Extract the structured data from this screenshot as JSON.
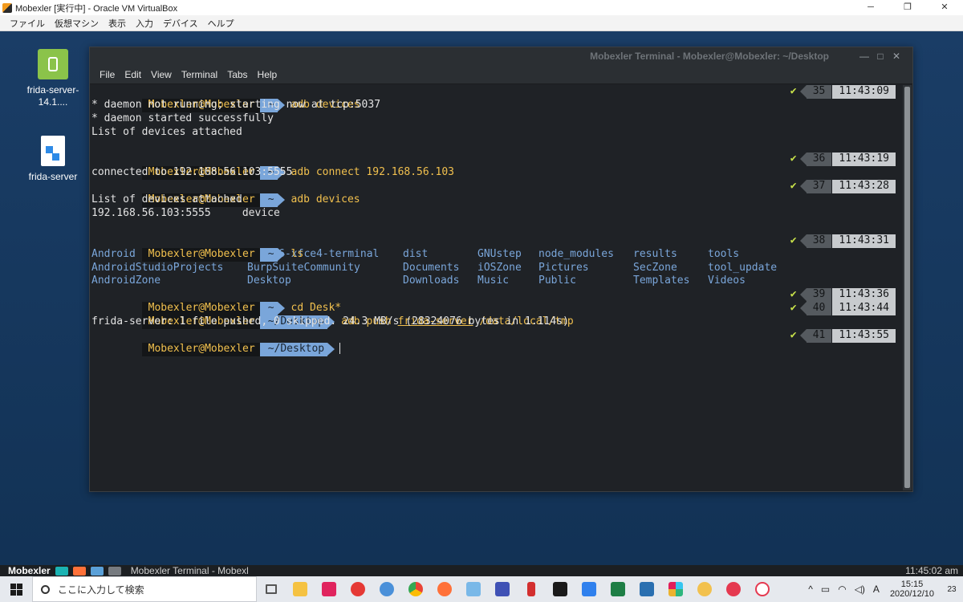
{
  "host": {
    "window_title": "Mobexler [実行中] - Oracle VM VirtualBox",
    "controls": {
      "minimize": "─",
      "restore": "❐",
      "close": "✕"
    },
    "menu": [
      "ファイル",
      "仮想マシン",
      "表示",
      "入力",
      "デバイス",
      "ヘルプ"
    ]
  },
  "desktop": {
    "icons": [
      {
        "label": "frida-server-14.1....",
        "icon": "apk-file-icon"
      },
      {
        "label": "frida-server",
        "icon": "binary-file-icon"
      }
    ]
  },
  "terminal": {
    "title": "Mobexler Terminal - Mobexler@Mobexler: ~/Desktop",
    "controls": {
      "minimize": "—",
      "maximize": "□",
      "close": "✕"
    },
    "menu": [
      "File",
      "Edit",
      "View",
      "Terminal",
      "Tabs",
      "Help"
    ],
    "prompt_user": "Mobexler@Mobexler",
    "check": "✔",
    "lines": {
      "p1": {
        "dir": "~",
        "cmd": "adb devices",
        "num": "35",
        "time": "11:43:09"
      },
      "o1": "* daemon not running; starting now at tcp:5037",
      "o2": "* daemon started successfully",
      "o3": "List of devices attached",
      "p2": {
        "dir": "~",
        "cmd": "adb connect 192.168.56.103",
        "num": "36",
        "time": "11:43:19"
      },
      "o4": "connected to 192.168.56.103:5555",
      "p3": {
        "dir": "~",
        "cmd": "adb devices",
        "num": "37",
        "time": "11:43:28"
      },
      "o5": "List of devices attached",
      "o6": "192.168.56.103:5555     device",
      "p4": {
        "dir": "~",
        "cmd": "ls",
        "num": "38",
        "time": "11:43:31"
      },
      "ls": [
        [
          "Android",
          "base16-xfce4-terminal",
          "dist",
          "GNUstep",
          "node_modules",
          "results",
          "tools"
        ],
        [
          "AndroidStudioProjects",
          "BurpSuiteCommunity",
          "Documents",
          "iOSZone",
          "Pictures",
          "SecZone",
          "tool_update"
        ],
        [
          "AndroidZone",
          "Desktop",
          "Downloads",
          "Music",
          "Public",
          "Templates",
          "Videos"
        ]
      ],
      "p5": {
        "dir": "~",
        "cmd": "cd Desk*",
        "num": "39",
        "time": "11:43:36"
      },
      "p6": {
        "dir": "~/Desktop",
        "cmd_pre": "adb push ",
        "cmd_u": "frida-server",
        "cmd_post": " /data/local/tmp",
        "num": "40",
        "time": "11:43:44"
      },
      "o7": "frida-server: 1 file pushed, 0 skipped. 24.3 MB/s (28324076 bytes in 1.114s)",
      "p7": {
        "dir": "~/Desktop",
        "num": "41",
        "time": "11:43:55"
      }
    }
  },
  "guest_panel": {
    "label": "Mobexler",
    "task": "Mobexler Terminal - Mobexl",
    "clock": "11:45:02 am"
  },
  "taskbar": {
    "search_placeholder": "ここに入力して検索",
    "apps": [
      {
        "name": "task-view",
        "color": "#555555"
      },
      {
        "name": "file-explorer",
        "color": "#f5c242"
      },
      {
        "name": "app-pink",
        "color": "#e0245e"
      },
      {
        "name": "app-sync",
        "color": "#e53935"
      },
      {
        "name": "app-draw",
        "color": "#4a90d9"
      },
      {
        "name": "chrome",
        "color": "#4caf50"
      },
      {
        "name": "firefox",
        "color": "#ff7139"
      },
      {
        "name": "app-notes",
        "color": "#79b8e8"
      },
      {
        "name": "app-dart",
        "color": "#3f51b5"
      },
      {
        "name": "app-red",
        "color": "#d32f2f"
      },
      {
        "name": "terminal",
        "color": "#1a1a1a"
      },
      {
        "name": "app-photos",
        "color": "#2f80ed"
      },
      {
        "name": "excel",
        "color": "#1e7e45"
      },
      {
        "name": "virtualbox",
        "color": "#2a6fb0"
      },
      {
        "name": "slack",
        "color": "#e01e5a"
      },
      {
        "name": "app-yellow",
        "color": "#f2c14e"
      },
      {
        "name": "app-oo",
        "color": "#e53950"
      },
      {
        "name": "app-oo2",
        "color": "#e53950"
      }
    ],
    "tray": {
      "chevron": "^",
      "ime": "A"
    },
    "time": "15:15",
    "date": "2020/12/10",
    "notifications": "23"
  }
}
